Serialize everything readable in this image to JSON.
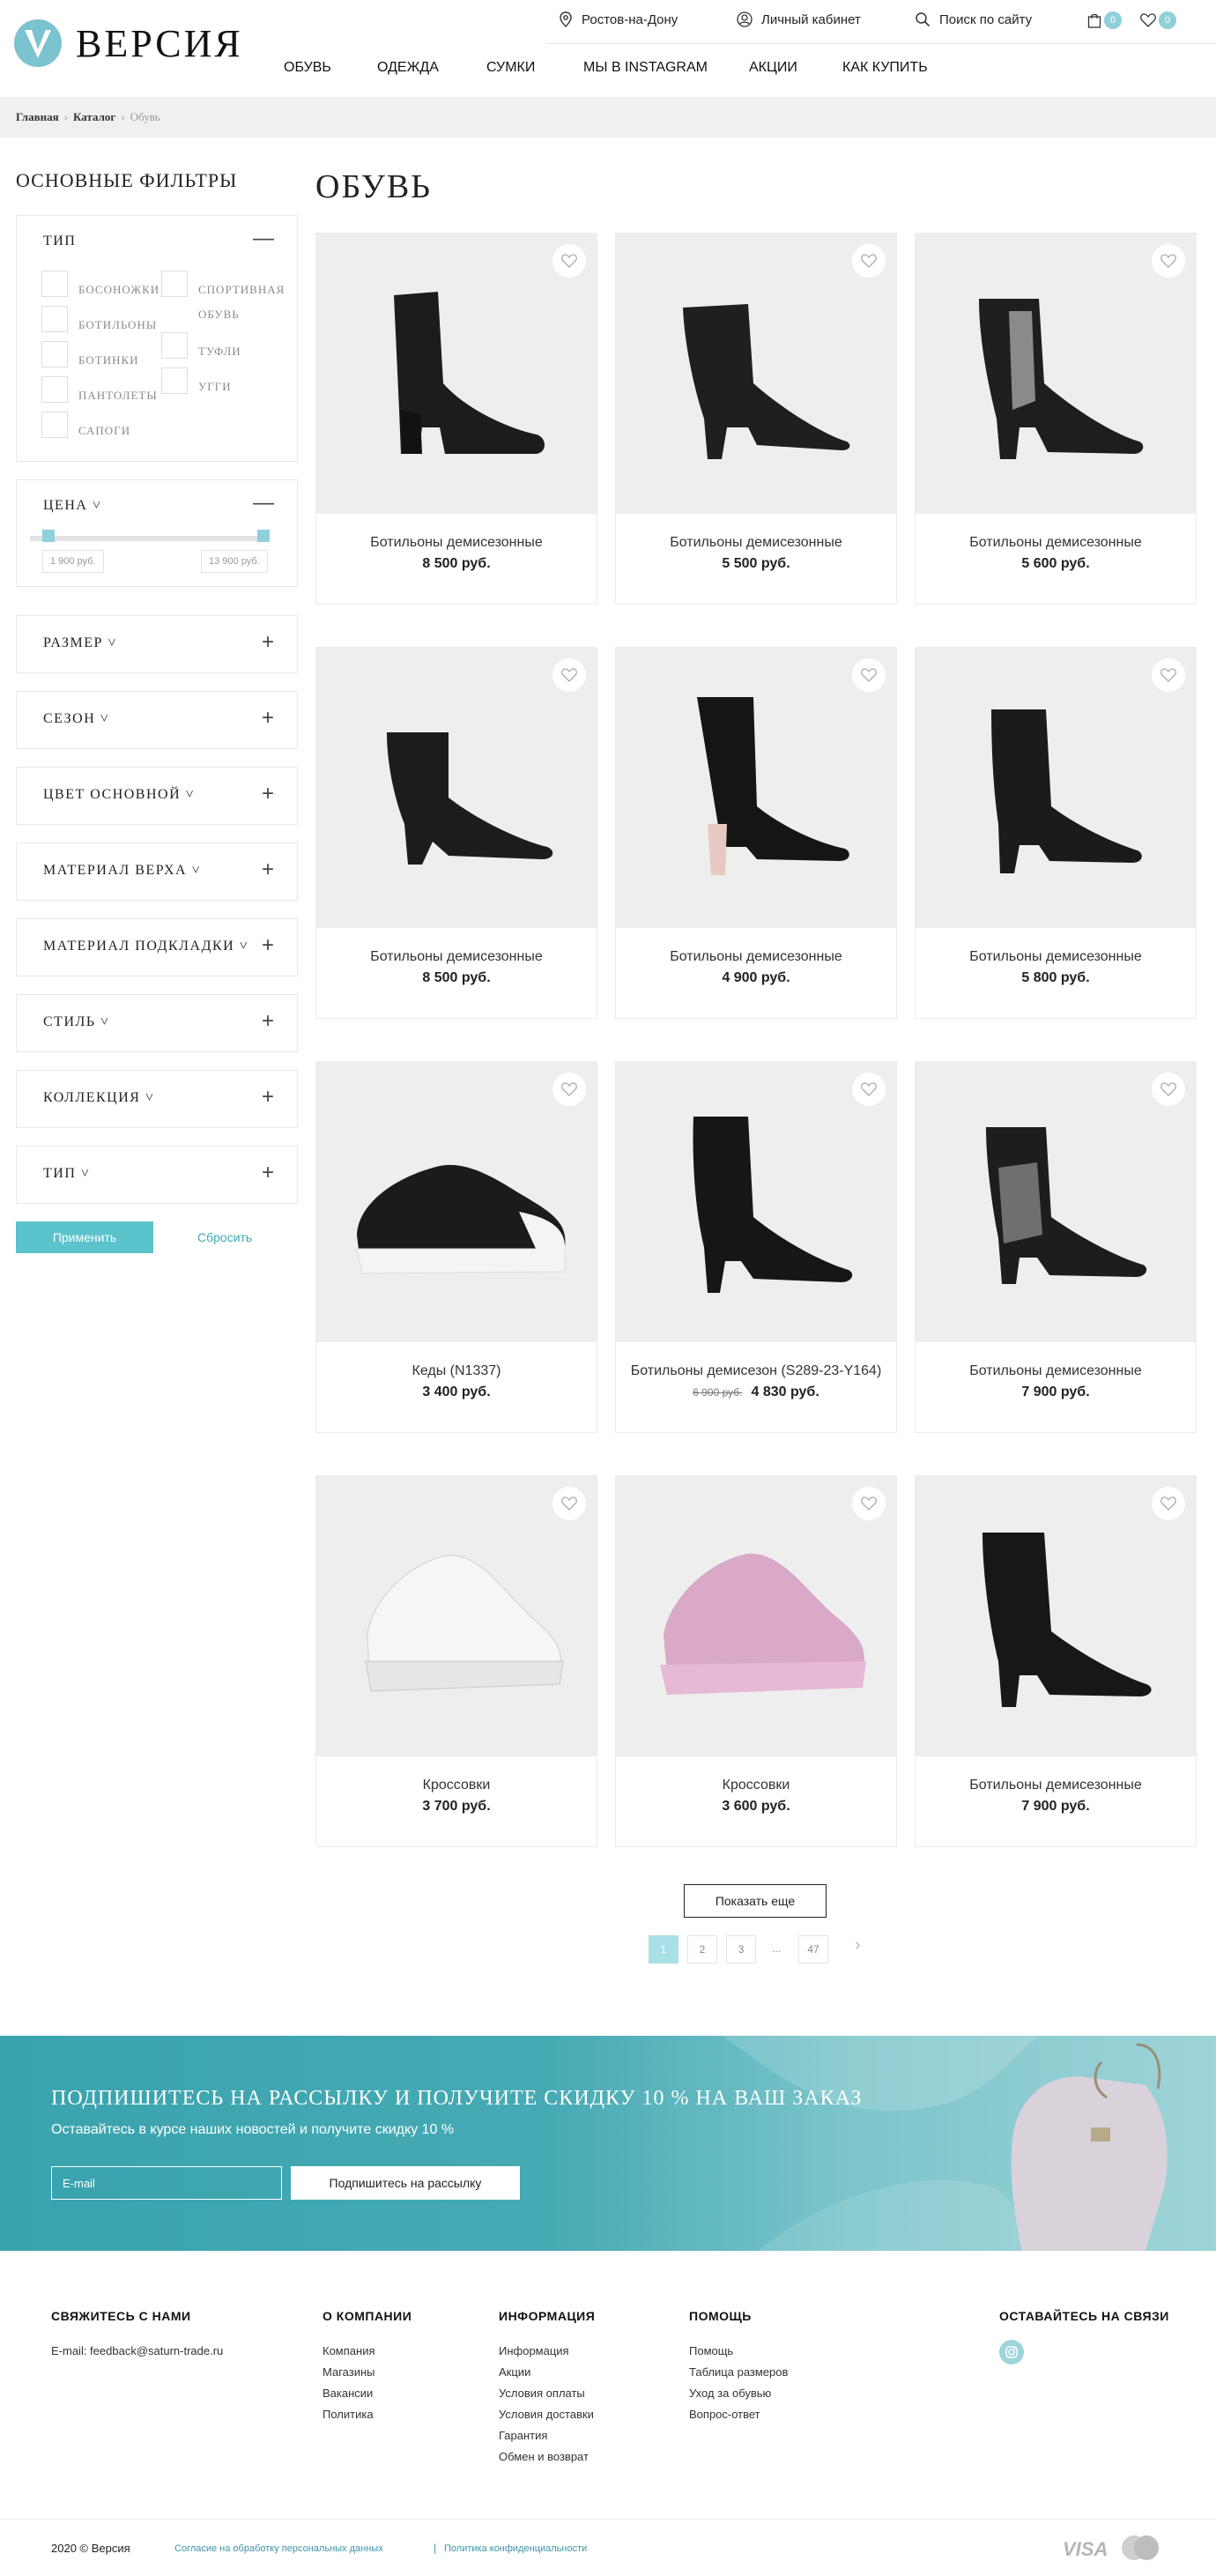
{
  "brand": {
    "name": "ВЕРСИЯ"
  },
  "topbar": {
    "city": "Ростов-на-Дону",
    "account": "Личный кабинет",
    "search": "Поиск по сайту",
    "cart_count": "0",
    "wishlist_count": "0"
  },
  "nav": [
    "ОБУВЬ",
    "ОДЕЖДА",
    "СУМКИ",
    "МЫ В INSTAGRAM",
    "АКЦИИ",
    "КАК КУПИТЬ"
  ],
  "breadcrumb": {
    "home": "Главная",
    "catalog": "Каталог",
    "current": "Обувь"
  },
  "sidebar": {
    "title": "ОСНОВНЫЕ ФИЛЬТРЫ",
    "type_filter": {
      "title": "ТИП",
      "left_options": [
        "БОСОНОЖКИ",
        "БОТИЛЬОНЫ",
        "БОТИНКИ",
        "ПАНТОЛЕТЫ",
        "САПОГИ"
      ],
      "right_options": [
        "СПОРТИВНАЯ ОБУВЬ",
        "ТУФЛИ",
        "УГГИ"
      ]
    },
    "price_filter": {
      "title": "ЦЕНА",
      "min": "1 900 руб.",
      "max": "13 900 руб."
    },
    "collapsed_filters": [
      "РАЗМЕР",
      "СЕЗОН",
      "ЦВЕТ ОСНОВНОЙ",
      "МАТЕРИАЛ ВЕРХА",
      "МАТЕРИАЛ ПОДКЛАДКИ",
      "СТИЛЬ",
      "КОЛЛЕКЦИЯ",
      "ТИП"
    ],
    "apply_label": "Применить",
    "reset_label": "Сбросить"
  },
  "page_title": "ОБУВЬ",
  "products": [
    {
      "name": "Ботильоны демисезонные",
      "price": "8 500 руб.",
      "old_price": ""
    },
    {
      "name": "Ботильоны демисезонные",
      "price": "5 500 руб.",
      "old_price": ""
    },
    {
      "name": "Ботильоны демисезонные",
      "price": "5 600 руб.",
      "old_price": ""
    },
    {
      "name": "Ботильоны демисезонные",
      "price": "8 500 руб.",
      "old_price": ""
    },
    {
      "name": "Ботильоны демисезонные",
      "price": "4 900 руб.",
      "old_price": ""
    },
    {
      "name": "Ботильоны демисезонные",
      "price": "5 800 руб.",
      "old_price": ""
    },
    {
      "name": "Кеды (N1337)",
      "price": "3 400 руб.",
      "old_price": ""
    },
    {
      "name": "Ботильоны демисезон (S289-23-Y164)",
      "price": "4 830 руб.",
      "old_price": "6 900 руб."
    },
    {
      "name": "Ботильоны демисезонные",
      "price": "7 900 руб.",
      "old_price": ""
    },
    {
      "name": "Кроссовки",
      "price": "3 700 руб.",
      "old_price": ""
    },
    {
      "name": "Кроссовки",
      "price": "3 600 руб.",
      "old_price": ""
    },
    {
      "name": "Ботильоны демисезонные",
      "price": "7 900 руб.",
      "old_price": ""
    }
  ],
  "show_more": "Показать еще",
  "pagination": {
    "pages": [
      "1",
      "2",
      "3"
    ],
    "dots": "...",
    "last": "47",
    "active": "1"
  },
  "newsletter": {
    "title": "ПОДПИШИТЕСЬ НА РАССЫЛКУ И ПОЛУЧИТЕ СКИДКУ 10 % НА ВАШ ЗАКАЗ",
    "subtitle": "Оставайтесь в курсе наших новостей и получите скидку 10 %",
    "email_placeholder": "E-mail",
    "button": "Подпишитесь на рассылку"
  },
  "footer": {
    "contact_title": "СВЯЖИТЕСЬ С НАМИ",
    "contact_email": "E-mail: feedback@saturn-trade.ru",
    "company_title": "О КОМПАНИИ",
    "company_links": [
      "Компания",
      "Магазины",
      "Вакансии",
      "Политика"
    ],
    "info_title": "ИНФОРМАЦИЯ",
    "info_links": [
      "Информация",
      "Акции",
      "Условия оплаты",
      "Условия доставки",
      "Гарантия",
      "Обмен и возврат"
    ],
    "help_title": "ПОМОЩЬ",
    "help_links": [
      "Помощь",
      "Таблица размеров",
      "Уход за обувью",
      "Вопрос-ответ"
    ],
    "social_title": "ОСТАВАЙТЕСЬ НА СВЯЗИ",
    "copyright": "2020 © Версия",
    "consent_link": "Согласие на обработку персональных данных",
    "legal_separator": "|",
    "privacy_link": "Политика конфиденциальности",
    "visa": "VISA"
  },
  "colors": {
    "accent": "#5bc3cc",
    "breadcrumb_bg": "#f1f0ef",
    "card_image_bg": "#eeeeee"
  }
}
